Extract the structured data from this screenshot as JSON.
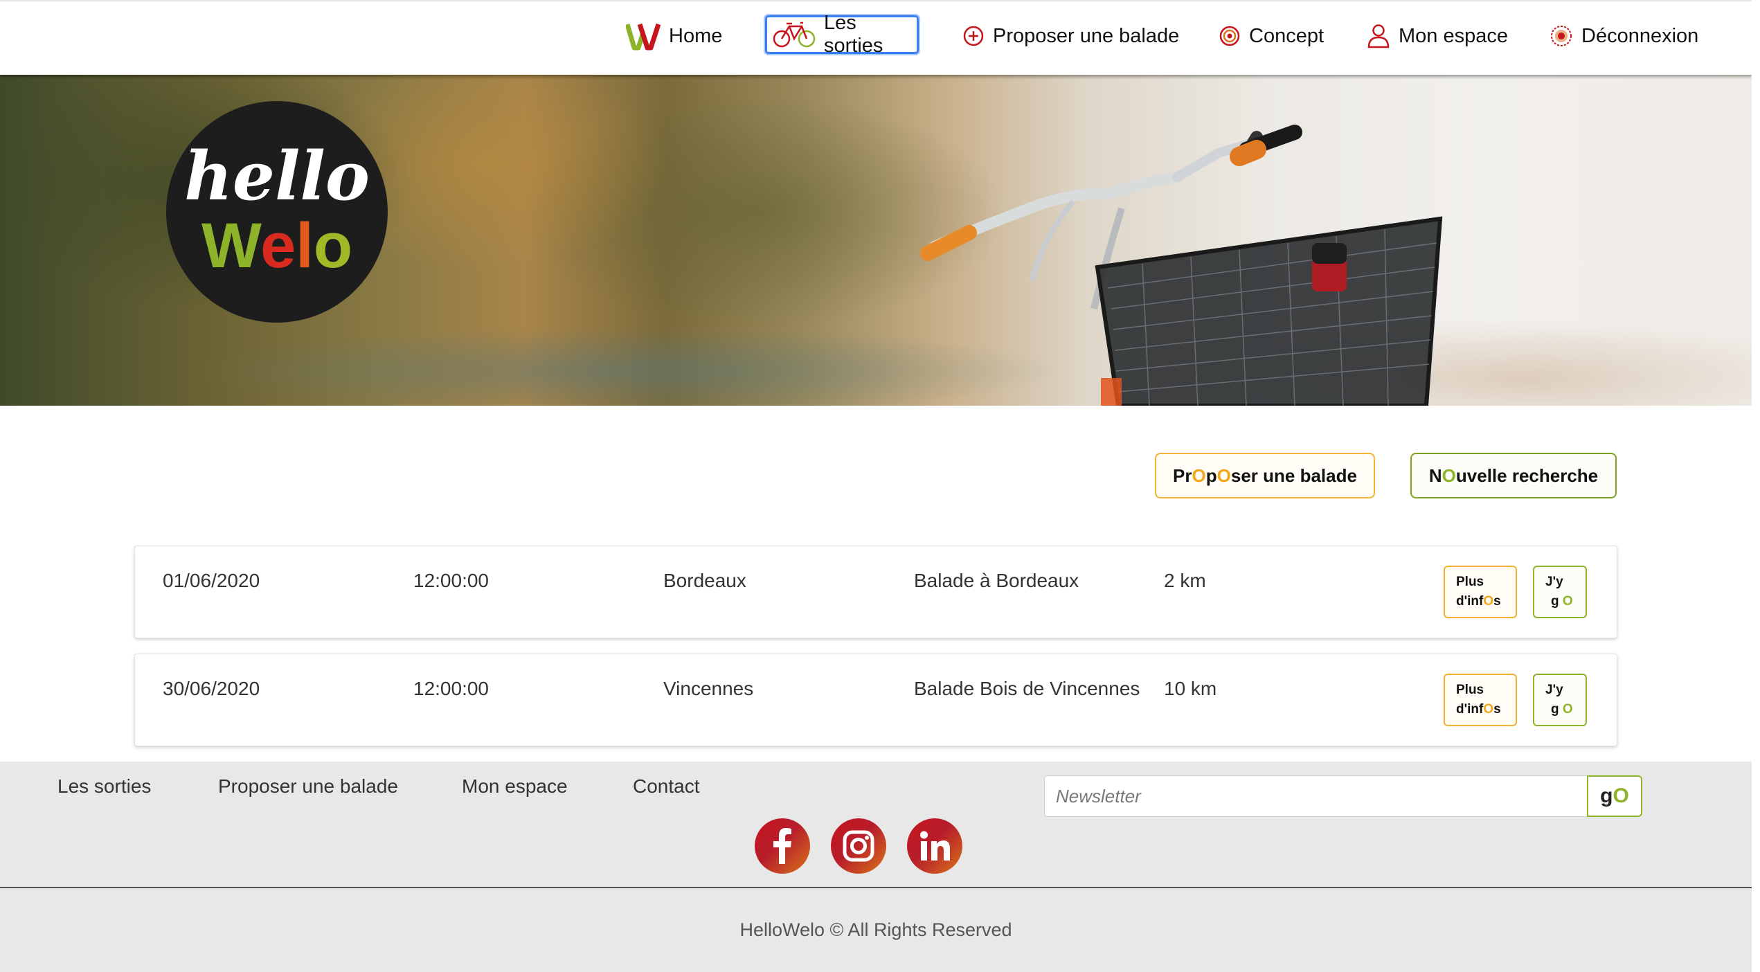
{
  "nav": {
    "items": [
      {
        "label": "Home",
        "icon": "hellowelo-w-icon"
      },
      {
        "label": "Les sorties",
        "icon": "bicycle-icon",
        "active": true
      },
      {
        "label": "Proposer une balade",
        "icon": "plus-circle-icon"
      },
      {
        "label": "Concept",
        "icon": "target-icon"
      },
      {
        "label": "Mon espace",
        "icon": "user-icon"
      },
      {
        "label": "Déconnexion",
        "icon": "power-icon"
      }
    ]
  },
  "hero": {
    "logo_line1": "hello",
    "logo_line2": "Welo"
  },
  "actions": {
    "propose": {
      "pre": "Pr",
      "o1": "O",
      "mid": "p",
      "o2": "O",
      "post": "ser une balade"
    },
    "new_search": {
      "pre": "N",
      "o": "O",
      "post": "uvelle recherche"
    }
  },
  "rides": [
    {
      "date": "01/06/2020",
      "time": "12:00:00",
      "city": "Bordeaux",
      "title": "Balade à Bordeaux",
      "distance": "2 km"
    },
    {
      "date": "30/06/2020",
      "time": "12:00:00",
      "city": "Vincennes",
      "title": "Balade Bois de Vincennes",
      "distance": "10 km"
    }
  ],
  "ride_buttons": {
    "info_line1": "Plus",
    "info_line2_pre": "d'inf",
    "info_line2_o": "O",
    "info_line2_post": "s",
    "go_line1": "J'y",
    "go_line2_pre": "g",
    "go_line2_o": "O"
  },
  "footer": {
    "links": [
      "Les sorties",
      "Proposer une balade",
      "Mon espace",
      "Contact"
    ],
    "newsletter_placeholder": "Newsletter",
    "go_pre": "g",
    "go_o": "O",
    "social": [
      "facebook-icon",
      "instagram-icon",
      "linkedin-icon"
    ],
    "copyright": "HelloWelo © All Rights Reserved"
  },
  "colors": {
    "brand_red": "#c5161d",
    "brand_green": "#8db32a",
    "brand_orange": "#f2a71b",
    "active_outline": "#3b7ff5"
  }
}
